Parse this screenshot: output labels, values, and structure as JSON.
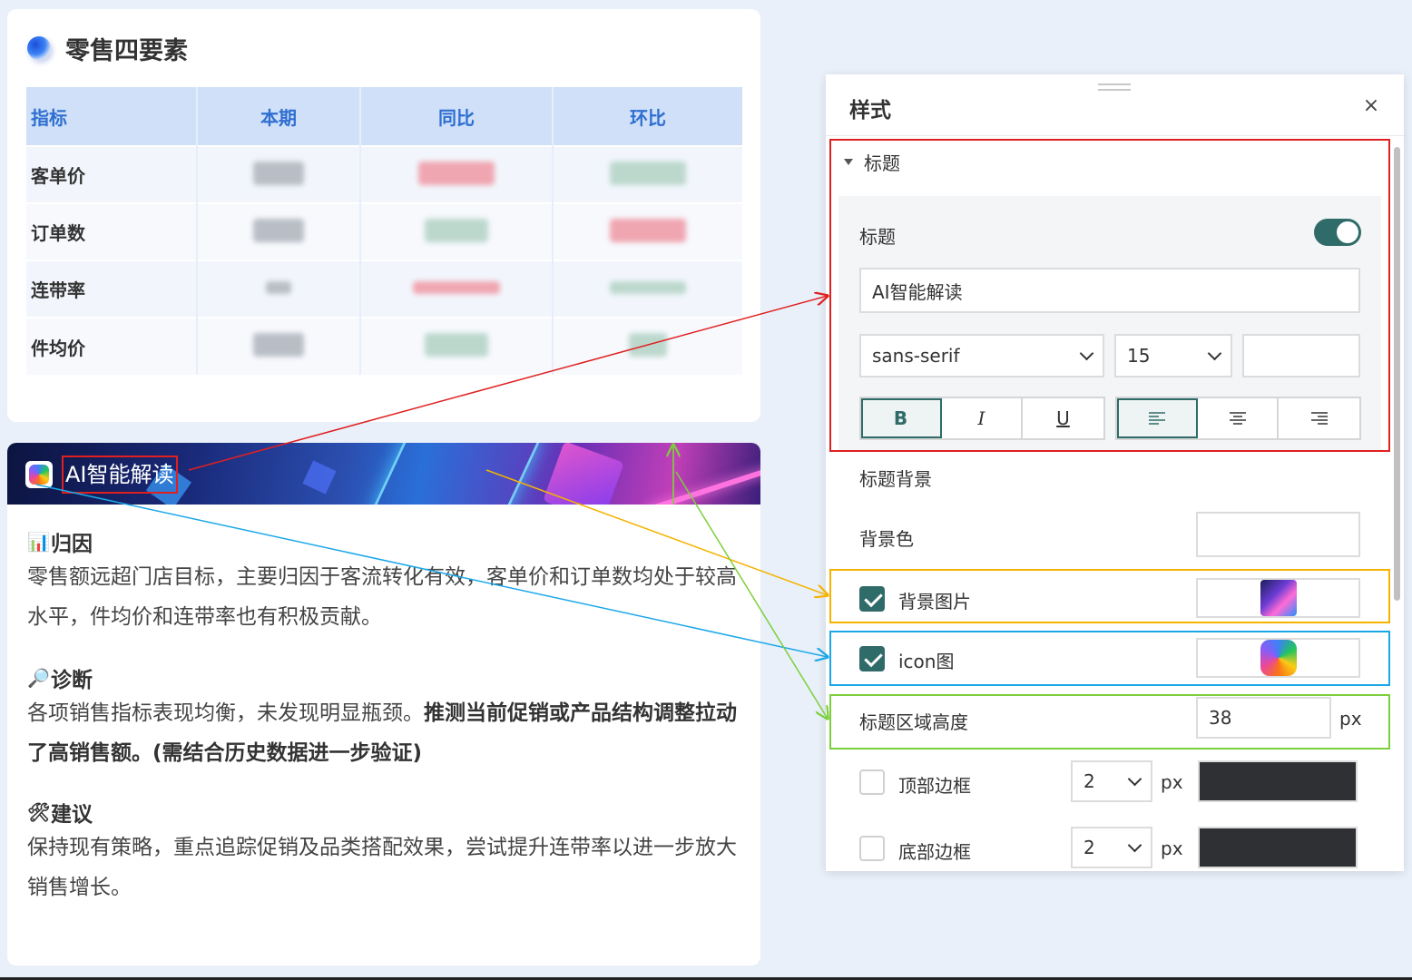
{
  "card1": {
    "title": "零售四要素",
    "headers": [
      "指标",
      "本期",
      "同比",
      "环比"
    ],
    "rows": [
      "客单价",
      "订单数",
      "连带率",
      "件均价"
    ]
  },
  "card2": {
    "banner_title": "AI智能解读",
    "sections": [
      {
        "icon": "bar-chart-icon",
        "heading": "归因",
        "text": "零售额远超门店目标，主要归因于客流转化有效，客单价和订单数均处于较高水平，件均价和连带率也有积极贡献。"
      },
      {
        "icon": "magnifier-icon",
        "heading": "诊断",
        "text_normal": "各项销售指标表现均衡，未发现明显瓶颈。",
        "text_bold": "推测当前促销或产品结构调整拉动了高销售额。(需结合历史数据进一步验证)"
      },
      {
        "icon": "tools-icon",
        "heading": "建议",
        "text": "保持现有策略，重点追踪促销及品类搭配效果，尝试提升连带率以进一步放大销售增长。"
      }
    ]
  },
  "panel": {
    "title": "样式",
    "close": "×",
    "section_title": "标题",
    "title_label": "标题",
    "title_toggle_on": true,
    "title_value": "AI智能解读",
    "font_family": "sans-serif",
    "font_size": "15",
    "format_buttons": [
      "B",
      "I",
      "U"
    ],
    "align_buttons": [
      "align-left",
      "align-center",
      "align-right"
    ],
    "bg_section": "标题背景",
    "bg_color_label": "背景色",
    "bg_image_label": "背景图片",
    "bg_image_checked": true,
    "icon_label": "icon图",
    "icon_checked": true,
    "height_label": "标题区域高度",
    "height_value": "38",
    "unit": "px",
    "top_border_label": "顶部边框",
    "top_border_value": "2",
    "bottom_border_label": "底部边框",
    "bottom_border_value": "2",
    "border_color": "#2e3033"
  },
  "colors": {
    "accent": "#2f6b68",
    "table_header_bg": "#cfe0f8",
    "table_header_text": "#2f6fd0",
    "highlight_red": "#e02020",
    "highlight_yellow": "#f5b300",
    "highlight_blue": "#1aa7e8",
    "highlight_green": "#7ccf3c"
  }
}
